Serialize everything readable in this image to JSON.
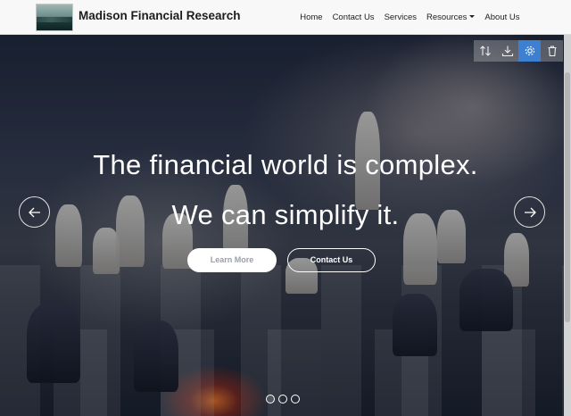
{
  "brand": {
    "name": "Madison Financial Research"
  },
  "nav": {
    "items": [
      {
        "label": "Home"
      },
      {
        "label": "Contact Us"
      },
      {
        "label": "Services"
      },
      {
        "label": "Resources",
        "has_dropdown": true
      },
      {
        "label": "About Us"
      }
    ]
  },
  "hero": {
    "headline_line1": "The financial world is complex.",
    "headline_line2": "We can simplify it.",
    "learn_more_label": "Learn More",
    "contact_label": "Contact Us",
    "slides_count": 3,
    "active_slide": 1
  },
  "toolbar": {
    "icons": [
      "sort-icon",
      "download-icon",
      "settings-icon",
      "trash-icon"
    ],
    "active": "settings-icon"
  },
  "colors": {
    "accent": "#3d7fd1",
    "navbar_bg": "#f8f8f8",
    "text_dark": "#1d1d1d"
  }
}
